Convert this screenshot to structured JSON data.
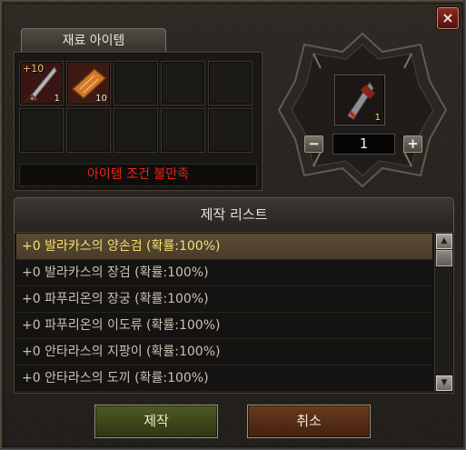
{
  "window": {
    "close_label": "×"
  },
  "materials": {
    "tab_label": "재료 아이템",
    "slots": [
      {
        "enhance": "+10",
        "qty": "1",
        "icon": "sword-icon"
      },
      {
        "enhance": "",
        "qty": "10",
        "icon": "scroll-icon"
      },
      {
        "enhance": "",
        "qty": ""
      },
      {
        "enhance": "",
        "qty": ""
      },
      {
        "enhance": "",
        "qty": ""
      },
      {
        "enhance": "",
        "qty": ""
      },
      {
        "enhance": "",
        "qty": ""
      },
      {
        "enhance": "",
        "qty": ""
      },
      {
        "enhance": "",
        "qty": ""
      },
      {
        "enhance": "",
        "qty": ""
      }
    ],
    "condition_text": "아이템 조건 불만족",
    "condition_color": "#e8231d"
  },
  "result": {
    "qty": "1",
    "icon": "greatsword-icon",
    "quantity_value": "1",
    "minus_label": "−",
    "plus_label": "+"
  },
  "craft_list": {
    "header": "제작 리스트",
    "items": [
      "+0 발라카스의 양손검 (확률:100%)",
      "+0 발라카스의 장검 (확률:100%)",
      "+0 파푸리온의 장궁 (확률:100%)",
      "+0 파푸리온의 이도류 (확률:100%)",
      "+0 안타라스의 지팡이 (확률:100%)",
      "+0 안타라스의 도끼 (확률:100%)"
    ],
    "selected_color": "#f3e070"
  },
  "buttons": {
    "craft": "제작",
    "cancel": "취소"
  }
}
